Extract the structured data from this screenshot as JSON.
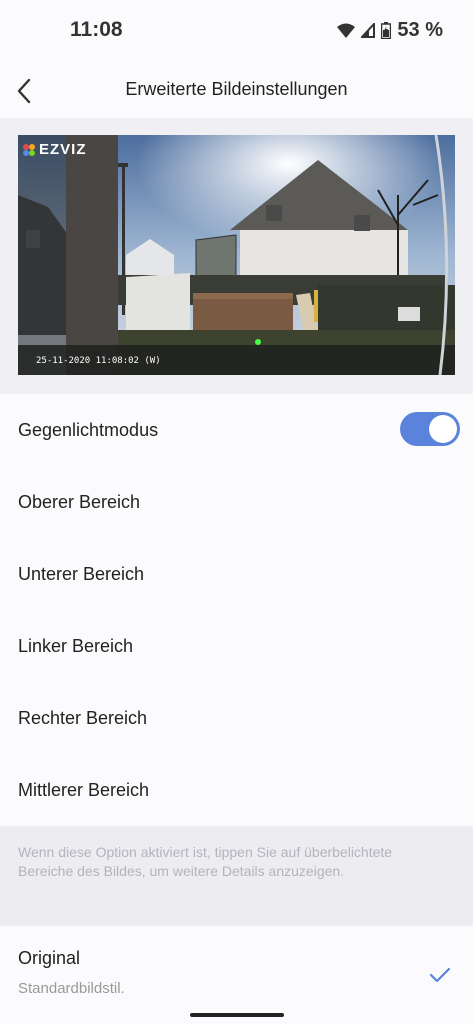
{
  "status_bar": {
    "time": "11:08",
    "battery": "53 %",
    "icons": [
      "wifi-icon",
      "signal-icon",
      "battery-icon"
    ]
  },
  "header": {
    "title": "Erweiterte Bildeinstellungen",
    "back_icon": "chevron-left-icon"
  },
  "preview": {
    "logo_text": "EZVIZ",
    "timestamp": "25-11-2020 11:08:02  (W)"
  },
  "settings": {
    "backlight": {
      "label": "Gegenlichtmodus",
      "enabled": true
    },
    "areas": [
      {
        "label": "Oberer Bereich"
      },
      {
        "label": "Unterer Bereich"
      },
      {
        "label": "Linker Bereich"
      },
      {
        "label": "Rechter Bereich"
      },
      {
        "label": "Mittlerer Bereich"
      }
    ],
    "hint": "Wenn diese Option aktiviert ist, tippen Sie auf überbelichtete Bereiche des Bildes, um weitere Details anzuzeigen."
  },
  "style_option": {
    "title": "Original",
    "subtitle": "Standardbildstil.",
    "selected": true
  },
  "colors": {
    "accent": "#5b83dc",
    "background": "#f0f0f4",
    "surface": "#fbfbfd"
  }
}
